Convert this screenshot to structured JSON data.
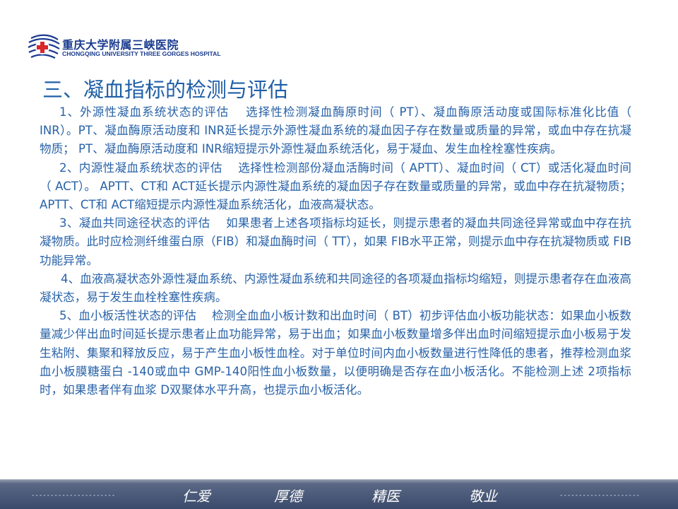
{
  "logo": {
    "name_cn": "重庆大学附属三峡医院",
    "name_en": "CHONGQING UNIVERSITY THREE GORGES HOSPITAL",
    "icon": "hospital-emblem-icon",
    "colors": {
      "primary": "#1a3b8f",
      "cross": "#d8262d"
    }
  },
  "heading": "三、凝血指标的检测与评估",
  "paragraphs": [
    "1、外源性凝血系统状态的评估　 选择性检测凝血酶原时间（ PT）、凝血酶原活动度或国际标准化比值（ INR）。PT、凝血酶原活动度和 INR延长提示外源性凝血系统的凝血因子存在数量或质量的异常，或血中存在抗凝物质； PT、凝血酶原活动度和 INR缩短提示外源性凝血系统活化，易于凝血、发生血栓栓塞性疾病。",
    "2、内源性凝血系统状态的评估　 选择性检测部份凝血活酶时间（ APTT）、凝血时间（ CT）或活化凝血时间（ ACT）。 APTT、CT和 ACT延长提示内源性凝血系统的凝血因子存在数量或质量的异常，或血中存在抗凝物质； APTT、CT和 ACT缩短提示内源性凝血系统活化，血液高凝状态。",
    "3、凝血共同途径状态的评估　 如果患者上述各项指标均延长，则提示患者的凝血共同途径异常或血中存在抗凝物质。此时应检测纤维蛋白原（FIB）和凝血酶时间（ TT），如果 FIB水平正常，则提示血中存在抗凝物质或 FIB功能异常。",
    "4、血液高凝状态外源性凝血系统、内源性凝血系统和共同途径的各项凝血指标均缩短，则提示患者存在血液高凝状态，易于发生血栓栓塞性疾病。",
    "5、血小板活性状态的评估　 检测全血血小板计数和出血时间（ BT）初步评估血小板功能状态：如果血小板数量减少伴出血时间延长提示患者止血功能异常，易于出血；如果血小板数量增多伴出血时间缩短提示血小板易于发生粘附、集聚和释放反应，易于产生血小板性血栓。对于单位时间内血小板数量进行性降低的患者，推荐检测血浆血小板膜糖蛋白 -140或血中 GMP-140阳性血小板数量，以便明确是否存在血小板活化。不能检测上述 2项指标时，如果患者伴有血浆 D双聚体水平升高，也提示血小板活化。"
  ],
  "footer": {
    "left_dashes": "----------------------",
    "motto": [
      "仁爱",
      "厚德",
      "精医",
      "敬业"
    ],
    "right_dashes": "---------------------"
  }
}
